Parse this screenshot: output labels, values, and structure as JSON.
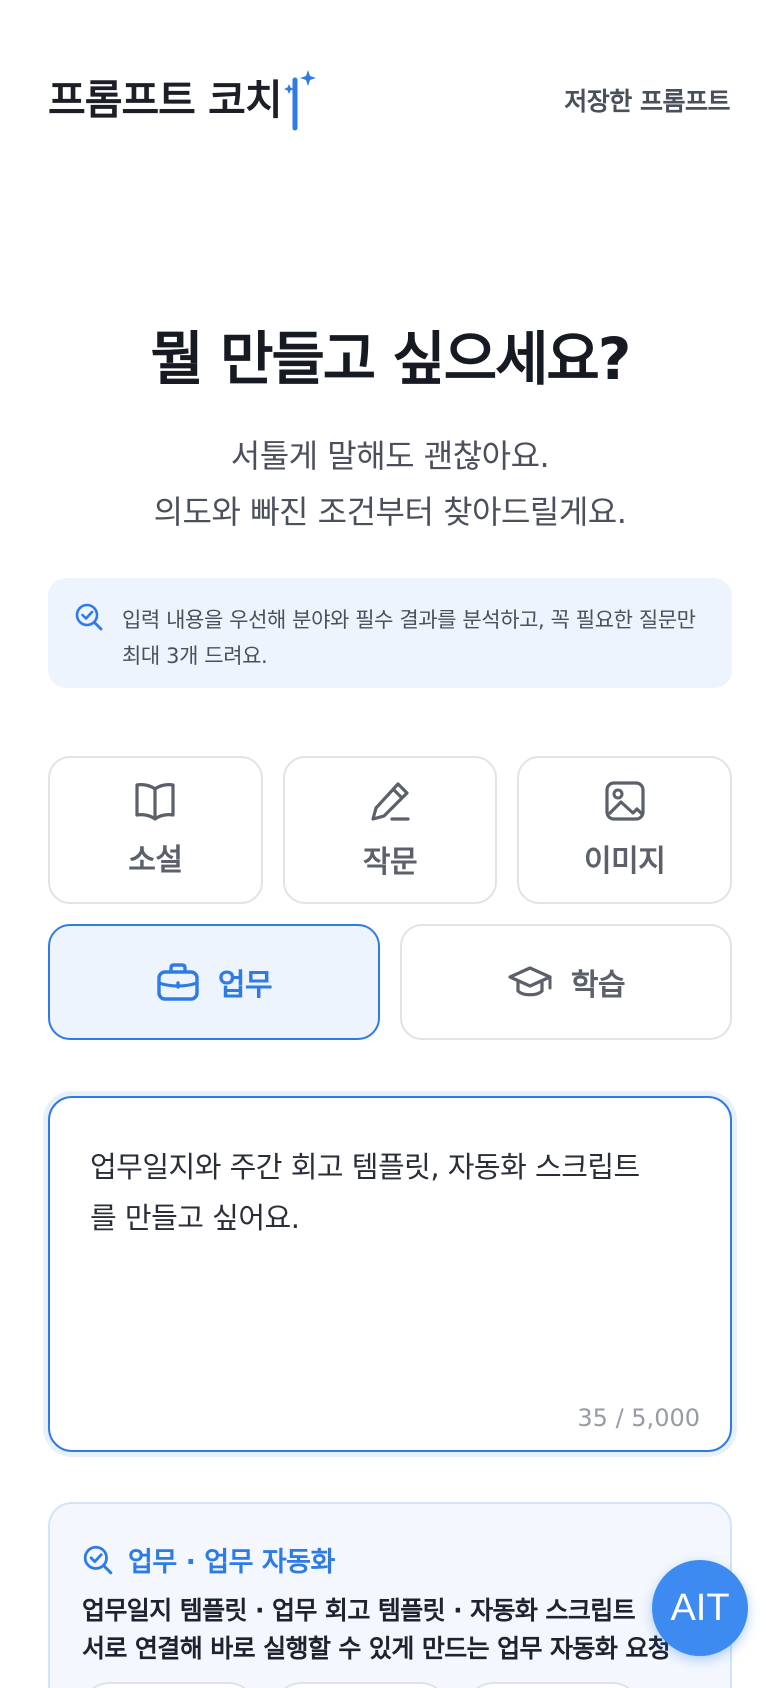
{
  "header": {
    "logo_text": "프롬프트 코치",
    "saved_link": "저장한 프롬프트"
  },
  "hero": {
    "title": "뭘 만들고 싶으세요?",
    "subtitle_line1": "서툴게 말해도 괜찮아요.",
    "subtitle_line2": "의도와 빠진 조건부터 찾아드릴게요."
  },
  "info": {
    "icon": "search-check-icon",
    "text": "입력 내용을 우선해 분야와 필수 결과를 분석하고, 꼭 필요한 질문만 최대 3개 드려요."
  },
  "categories": [
    {
      "label": "소설",
      "icon": "book-icon",
      "active": false
    },
    {
      "label": "작문",
      "icon": "pencil-icon",
      "active": false
    },
    {
      "label": "이미지",
      "icon": "image-icon",
      "active": false
    },
    {
      "label": "업무",
      "icon": "briefcase-icon",
      "active": true
    },
    {
      "label": "학습",
      "icon": "graduation-cap-icon",
      "active": false
    }
  ],
  "input": {
    "value": "업무일지와 주간 회고 템플릿, 자동화 스크립트를 만들고 싶어요.",
    "char_count": "35 / 5,000"
  },
  "analysis": {
    "icon": "search-check-icon",
    "title": "업무 · 업무 자동화",
    "line1": "업무일지 템플릿 · 업무 회고 템플릿 · 자동화 스크립트",
    "line2": "서로 연결해 바로 실행할 수 있게 만드는 업무 자동화 요청"
  },
  "fab": {
    "label": "AIT"
  },
  "colors": {
    "accent": "#2f7be6",
    "accent_bg": "#eef4fd",
    "border": "#e1e3e8",
    "text_dark": "#1c1f27",
    "text_muted": "#5b606b"
  }
}
